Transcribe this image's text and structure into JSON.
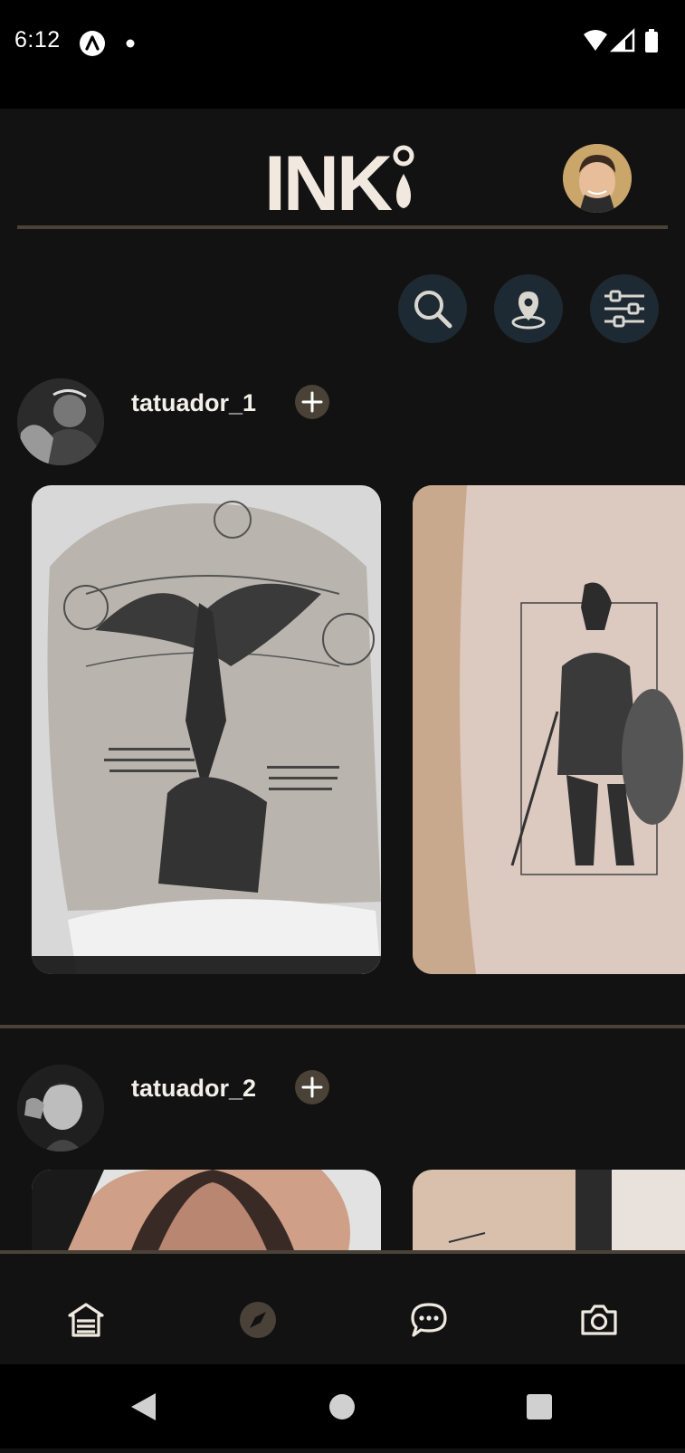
{
  "status_bar": {
    "time": "6:12"
  },
  "app": {
    "logo_text": "INK"
  },
  "artists": [
    {
      "name": "tatuador_1"
    },
    {
      "name": "tatuador_2"
    }
  ],
  "colors": {
    "background": "#121212",
    "divider": "#4a4238",
    "round_button": "#1d2a33",
    "follow_button": "#4a4137",
    "text": "#f2efe9"
  },
  "icons": {
    "status_left": [
      "a-logo-icon",
      "dot-icon"
    ],
    "status_right": [
      "wifi-icon",
      "signal-icon",
      "battery-icon"
    ],
    "actions": [
      "search-icon",
      "location-icon",
      "filter-icon"
    ],
    "nav": [
      "home-icon",
      "compass-icon",
      "chat-icon",
      "camera-icon"
    ],
    "system": [
      "back-icon",
      "home-circle-icon",
      "recents-icon"
    ]
  }
}
